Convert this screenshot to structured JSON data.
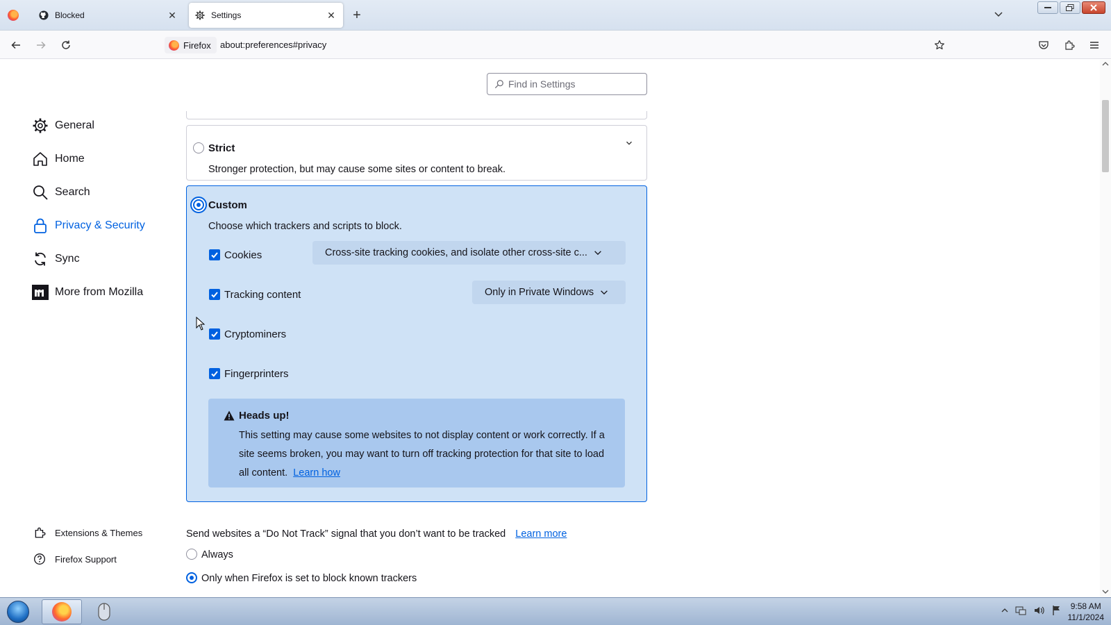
{
  "browser": {
    "tabs": [
      {
        "label": "Blocked",
        "icon": "github-icon",
        "active": false
      },
      {
        "label": "Settings",
        "icon": "gear-icon",
        "active": true
      }
    ],
    "identity_label": "Firefox",
    "url": "about:preferences#privacy"
  },
  "settings": {
    "search_placeholder": "Find in Settings",
    "sidebar": {
      "items": [
        {
          "label": "General",
          "icon": "gear-icon"
        },
        {
          "label": "Home",
          "icon": "home-icon"
        },
        {
          "label": "Search",
          "icon": "search-icon"
        },
        {
          "label": "Privacy & Security",
          "icon": "lock-icon",
          "active": true
        },
        {
          "label": "Sync",
          "icon": "sync-icon"
        },
        {
          "label": "More from Mozilla",
          "icon": "mozilla-icon"
        }
      ],
      "footer": [
        {
          "label": "Extensions & Themes",
          "icon": "puzzle-icon"
        },
        {
          "label": "Firefox Support",
          "icon": "help-icon"
        }
      ]
    },
    "strict": {
      "title": "Strict",
      "description": "Stronger protection, but may cause some sites or content to break."
    },
    "custom": {
      "title": "Custom",
      "description": "Choose which trackers and scripts to block.",
      "options": [
        {
          "label": "Cookies",
          "checked": true,
          "dropdown": "Cross-site tracking cookies, and isolate other cross-site c..."
        },
        {
          "label": "Tracking content",
          "checked": true,
          "dropdown": "Only in Private Windows"
        },
        {
          "label": "Cryptominers",
          "checked": true
        },
        {
          "label": "Fingerprinters",
          "checked": true
        }
      ],
      "warning": {
        "title": "Heads up!",
        "text": "This setting may cause some websites to not display content or work correctly. If a site seems broken, you may want to turn off tracking protection for that site to load all content.",
        "link": "Learn how"
      }
    },
    "dnt": {
      "text": "Send websites a “Do Not Track” signal that you don’t want to be tracked",
      "link": "Learn more",
      "options": [
        {
          "label": "Always",
          "selected": false
        },
        {
          "label": "Only when Firefox is set to block known trackers",
          "selected": true
        }
      ]
    }
  },
  "taskbar": {
    "time": "9:58 AM",
    "date": "11/1/2024"
  },
  "colors": {
    "accent": "#0061e0",
    "custom_bg": "#cfe2f6",
    "warning_bg": "#a9c8ee"
  }
}
